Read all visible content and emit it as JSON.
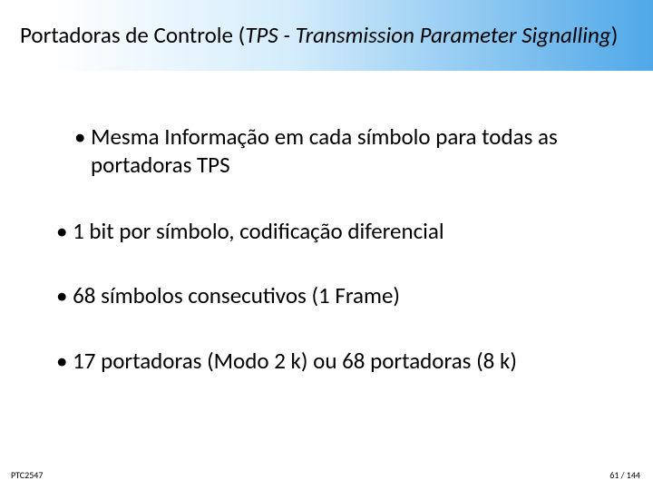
{
  "title": {
    "plain_prefix": "Portadoras de Controle (",
    "italic_part": "TPS - Transmission Parameter Signalling",
    "plain_suffix": ")"
  },
  "bullets": {
    "b1": "• Mesma Informação em cada símbolo para todas as portadoras TPS",
    "b2": "• 1 bit por símbolo, codificação diferencial",
    "b3": "• 68 símbolos consecutivos (1 Frame)",
    "b4": "• 17 portadoras (Modo 2 k) ou 68 portadoras (8 k)"
  },
  "footer": {
    "left": "PTC2547",
    "right": "61 / 144"
  }
}
